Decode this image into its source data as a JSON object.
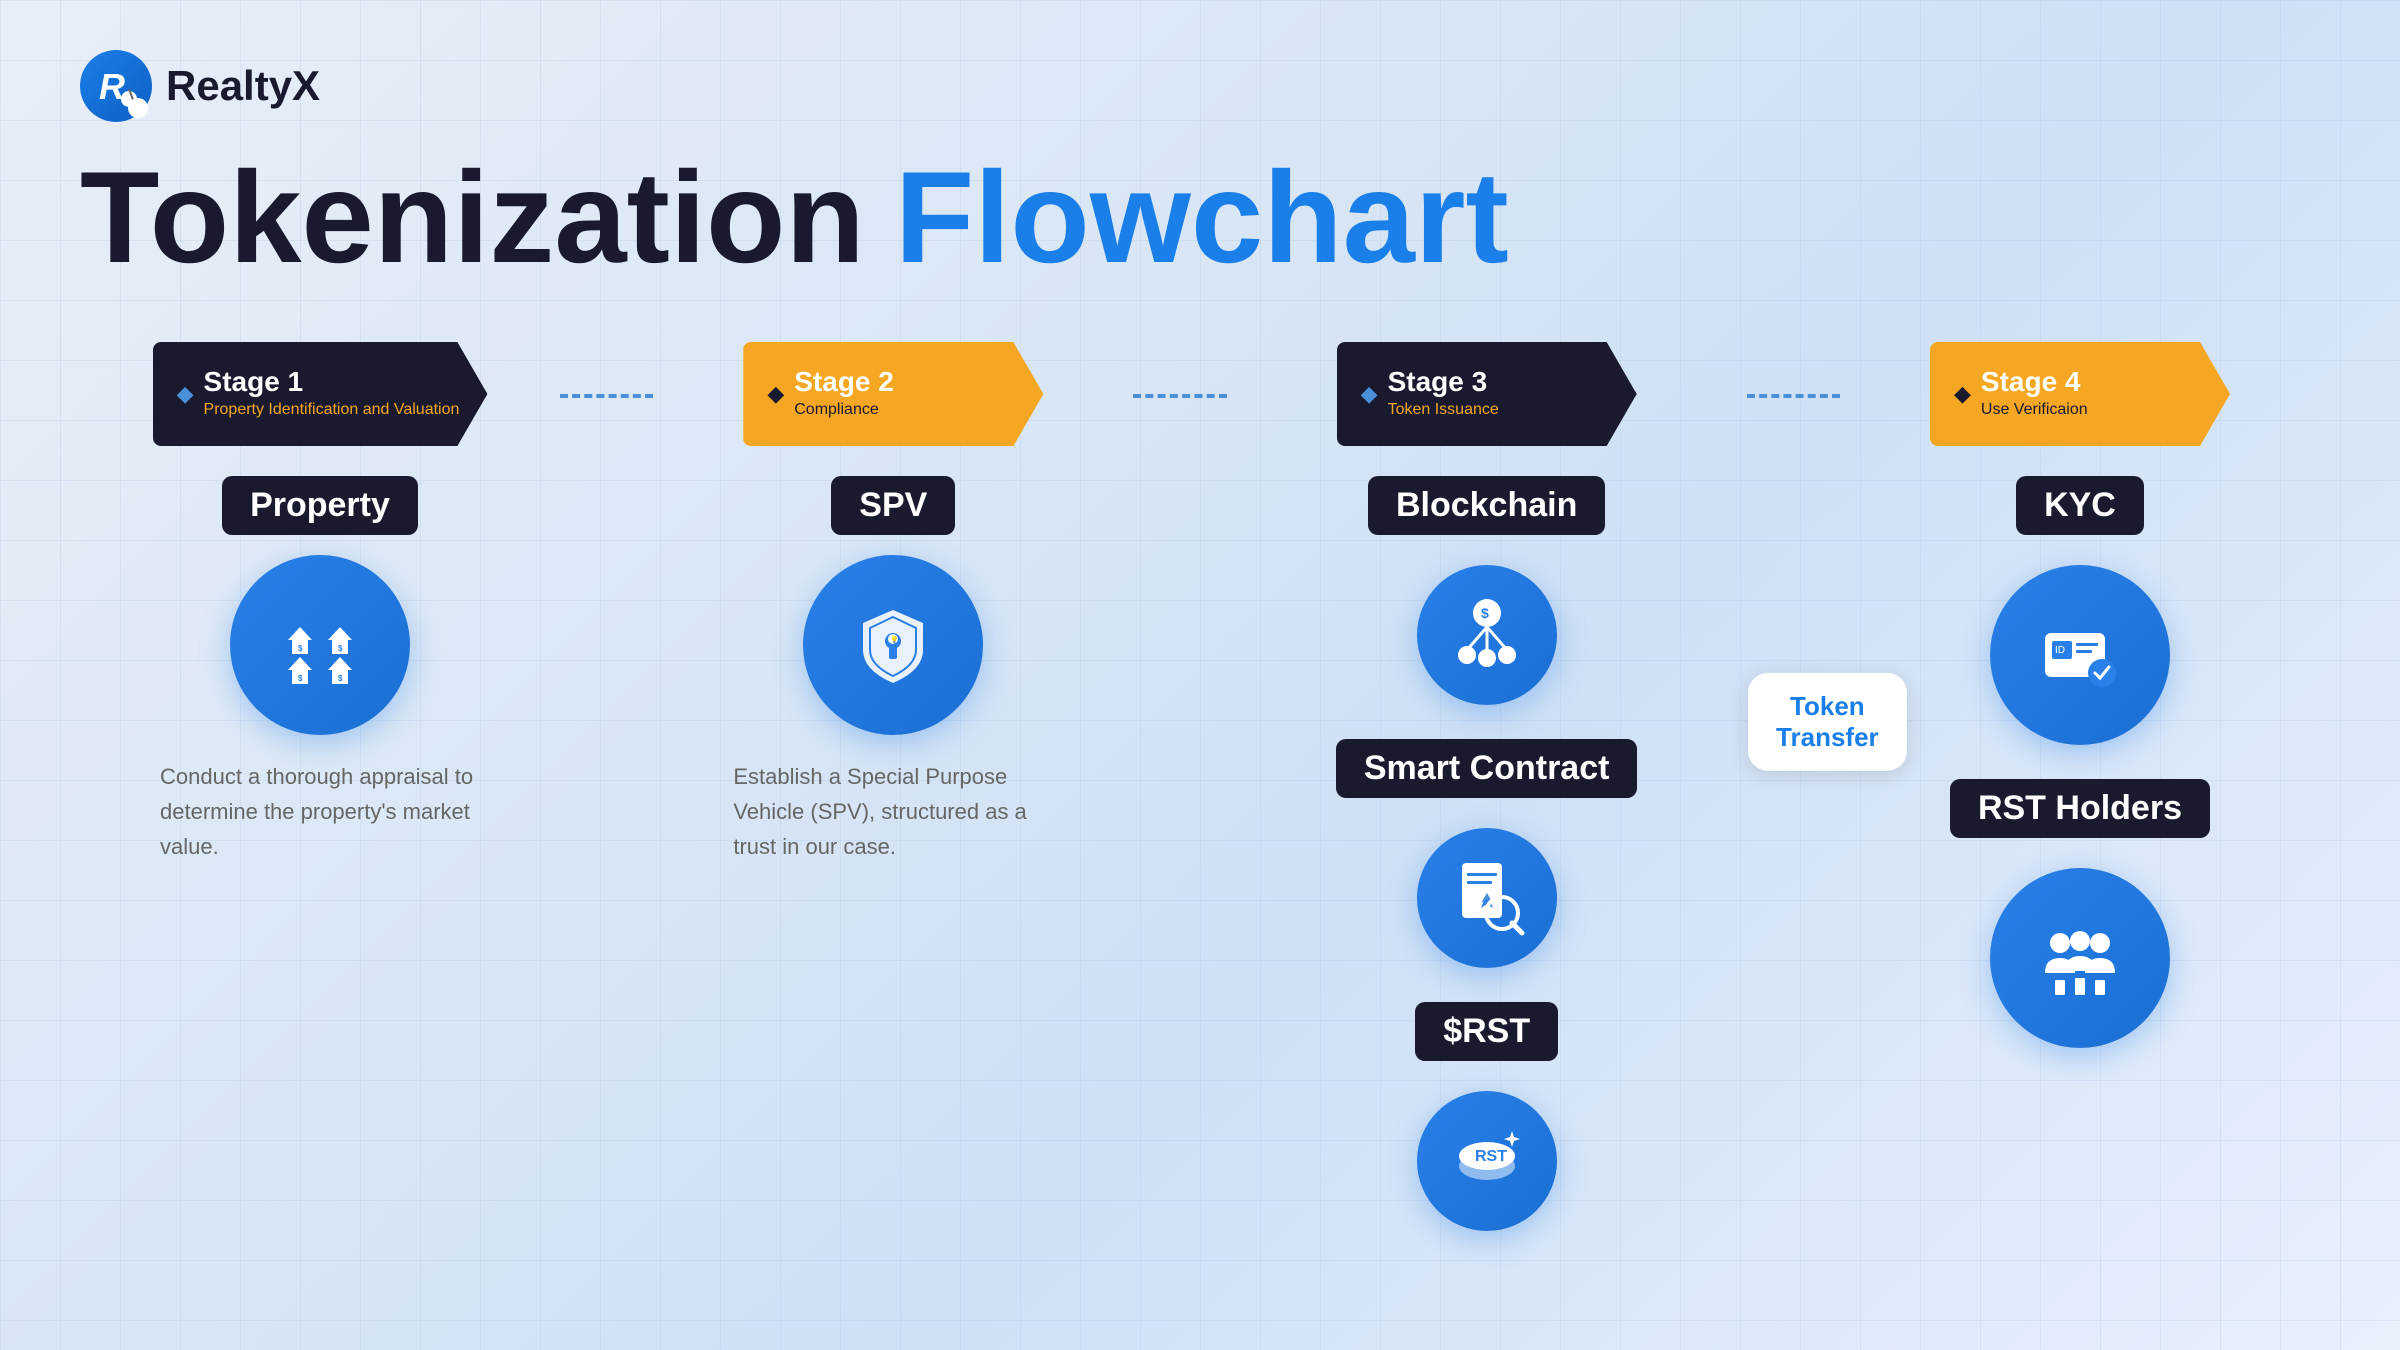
{
  "logo": {
    "letter": "R",
    "name": "RealtyX"
  },
  "title": {
    "part1": "Tokenization",
    "part2": "Flowchart"
  },
  "stages": [
    {
      "id": "stage1",
      "num": "Stage 1",
      "sub": "Property Identification and Valuation",
      "color": "black",
      "item_label": "Property",
      "description": "Conduct a thorough appraisal to determine the property's market value."
    },
    {
      "id": "stage2",
      "num": "Stage 2",
      "sub": "Compliance",
      "color": "gold",
      "item_label": "SPV",
      "description": "Establish a Special Purpose Vehicle (SPV), structured as a trust in our case."
    },
    {
      "id": "stage3",
      "num": "Stage 3",
      "sub": "Token Issuance",
      "color": "black",
      "items": [
        "Blockchain",
        "Smart Contract",
        "$RST"
      ],
      "token_transfer_label": "Token",
      "token_transfer_label2": "Transfer"
    },
    {
      "id": "stage4",
      "num": "Stage 4",
      "sub": "Use Verificaion",
      "color": "gold",
      "items": [
        "KYC",
        "RST Holders"
      ]
    }
  ],
  "diamond_symbol": "◆"
}
